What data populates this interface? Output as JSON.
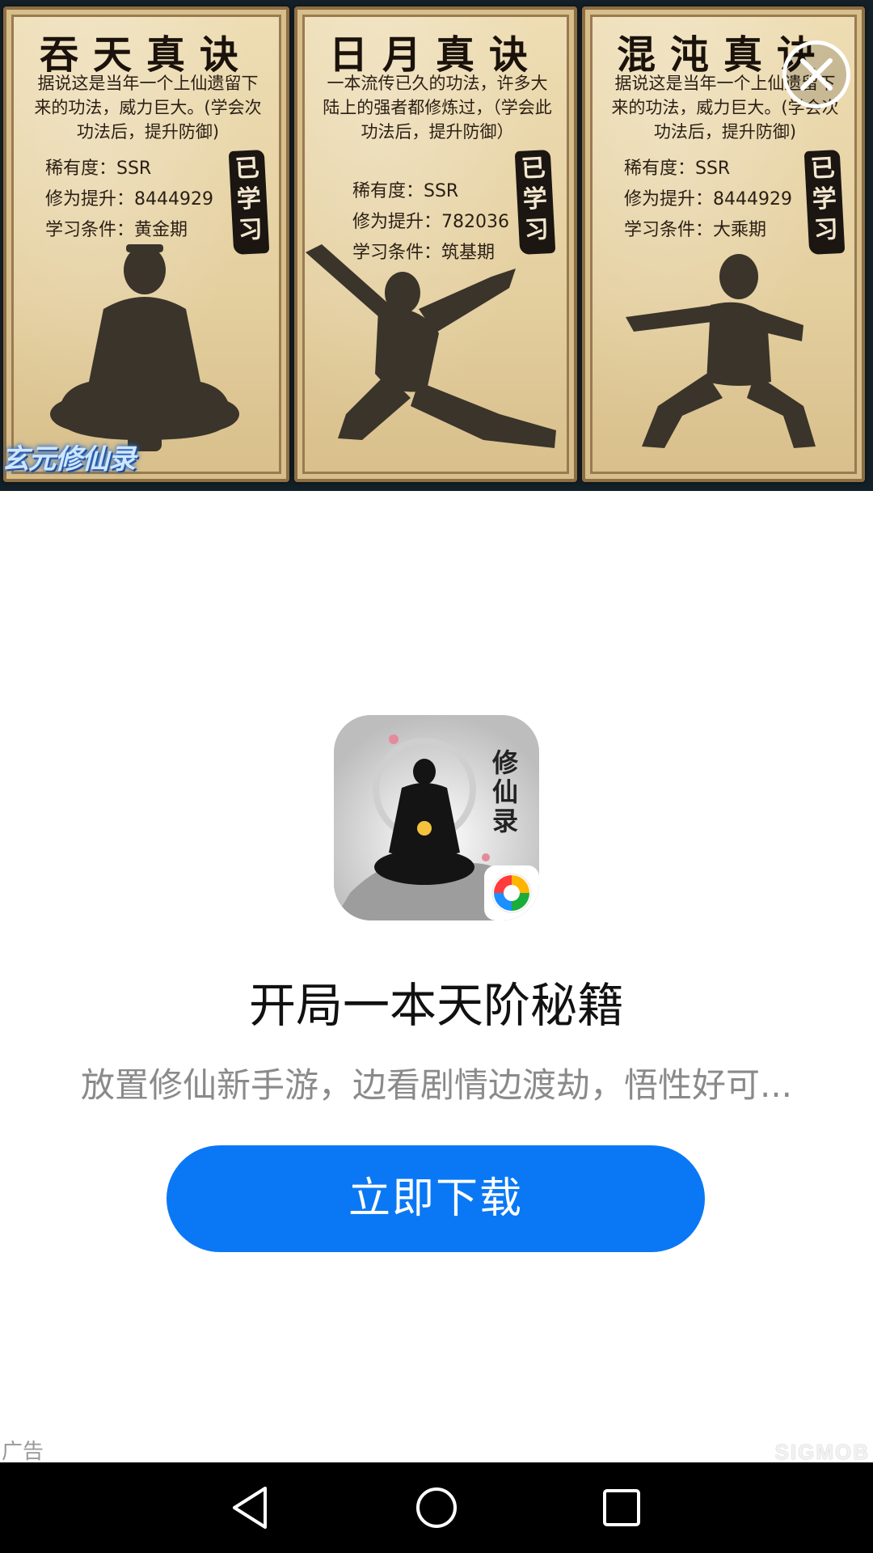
{
  "banner": {
    "cards": [
      {
        "title": "吞天真诀",
        "description": "据说这是当年一个上仙遗留下来的功法，威力巨大。(学会次功法后，提升防御)",
        "rarity": "稀有度：SSR",
        "cultivation": "修为提升：8444929",
        "condition": "学习条件：黄金期",
        "status": "已学习"
      },
      {
        "title": "日月真诀",
        "description": "一本流传已久的功法，许多大陆上的强者都修炼过，（学会此功法后，提升防御）",
        "rarity": "稀有度：SSR",
        "cultivation": "修为提升：782036",
        "condition": "学习条件：筑基期",
        "status": "已学习"
      },
      {
        "title": "混沌真诀",
        "description": "据说这是当年一个上仙遗留下来的功法，威力巨大。(学会次功法后，提升防御)",
        "rarity": "稀有度：SSR",
        "cultivation": "修为提升：8444929",
        "condition": "学习条件：大乘期",
        "status": "已学习"
      }
    ],
    "game_logo": "玄元修仙录",
    "close_icon": "close-icon"
  },
  "ad": {
    "app_icon_name": "app-icon",
    "title": "开局一本天阶秘籍",
    "description": "放置修仙新手游，边看剧情边渡劫，悟性好可...",
    "download_label": "立即下载",
    "ad_label": "广告",
    "provider": "SIGMOB",
    "accent_color": "#0a78f5"
  },
  "navbar": {
    "back_icon": "back-icon",
    "home_icon": "home-icon",
    "recent_icon": "recent-apps-icon"
  }
}
